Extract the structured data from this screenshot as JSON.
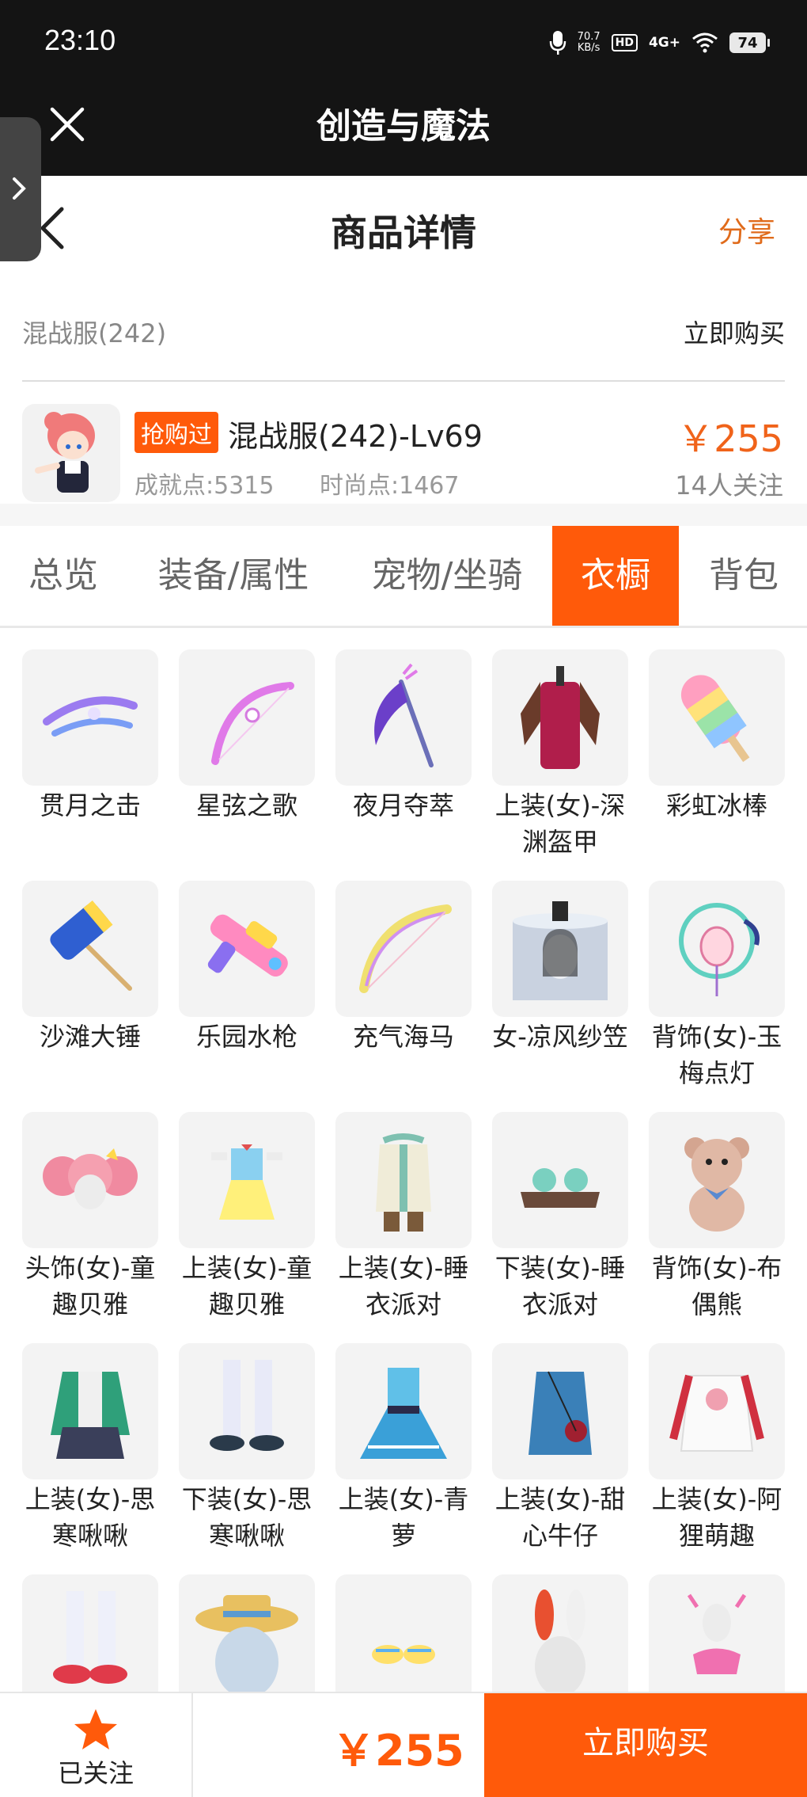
{
  "status": {
    "time": "23:10",
    "speed_value": "70.7",
    "speed_unit": "KB/s",
    "hd": "HD",
    "network": "4G+",
    "battery": "74"
  },
  "app": {
    "title": "创造与魔法"
  },
  "header": {
    "title": "商品详情",
    "share": "分享"
  },
  "server": {
    "name": "混战服(242)",
    "buy_now": "立即购买"
  },
  "product": {
    "badge": "抢购过",
    "name": "混战服(242)-Lv69",
    "achievement": "成就点:5315",
    "fashion": "时尚点:1467",
    "price": "￥255",
    "followers": "14人关注"
  },
  "tabs": [
    {
      "label": "总览",
      "active": false
    },
    {
      "label": "装备/属性",
      "active": false
    },
    {
      "label": "宠物/坐骑",
      "active": false
    },
    {
      "label": "衣橱",
      "active": true
    },
    {
      "label": "背包",
      "active": false
    }
  ],
  "items": [
    {
      "name": "贯月之击",
      "icon": "crossbow-icon"
    },
    {
      "name": "星弦之歌",
      "icon": "bow-icon"
    },
    {
      "name": "夜月夺萃",
      "icon": "scythe-icon"
    },
    {
      "name": "上装(女)-深渊盔甲",
      "icon": "armor-icon"
    },
    {
      "name": "彩虹冰棒",
      "icon": "popsicle-icon"
    },
    {
      "name": "沙滩大锤",
      "icon": "hammer-icon"
    },
    {
      "name": "乐园水枪",
      "icon": "watergun-icon"
    },
    {
      "name": "充气海马",
      "icon": "seahorse-bow-icon"
    },
    {
      "name": "女-凉风纱笠",
      "icon": "veil-hat-icon"
    },
    {
      "name": "背饰(女)-玉梅点灯",
      "icon": "lantern-icon"
    },
    {
      "name": "头饰(女)-童趣贝雅",
      "icon": "hair-icon"
    },
    {
      "name": "上装(女)-童趣贝雅",
      "icon": "dress-icon"
    },
    {
      "name": "上装(女)-睡衣派对",
      "icon": "pajama-top-icon"
    },
    {
      "name": "下装(女)-睡衣派对",
      "icon": "slippers-icon"
    },
    {
      "name": "背饰(女)-布偶熊",
      "icon": "teddy-bear-icon"
    },
    {
      "name": "上装(女)-思寒啾啾",
      "icon": "jacket-icon"
    },
    {
      "name": "下装(女)-思寒啾啾",
      "icon": "stockings-icon"
    },
    {
      "name": "上装(女)-青萝",
      "icon": "blue-dress-icon"
    },
    {
      "name": "上装(女)-甜心牛仔",
      "icon": "denim-icon"
    },
    {
      "name": "上装(女)-阿狸萌趣",
      "icon": "hoodie-icon"
    },
    {
      "name": "",
      "icon": "socks-icon"
    },
    {
      "name": "",
      "icon": "straw-hat-icon"
    },
    {
      "name": "",
      "icon": "shoes-icon"
    },
    {
      "name": "",
      "icon": "bunny-ears-icon"
    },
    {
      "name": "",
      "icon": "swimsuit-icon"
    }
  ],
  "bottom": {
    "follow_label": "已关注",
    "price": "￥255",
    "buy_label": "立即购买"
  },
  "colors": {
    "accent": "#ff5a0a",
    "dark": "#141414"
  }
}
